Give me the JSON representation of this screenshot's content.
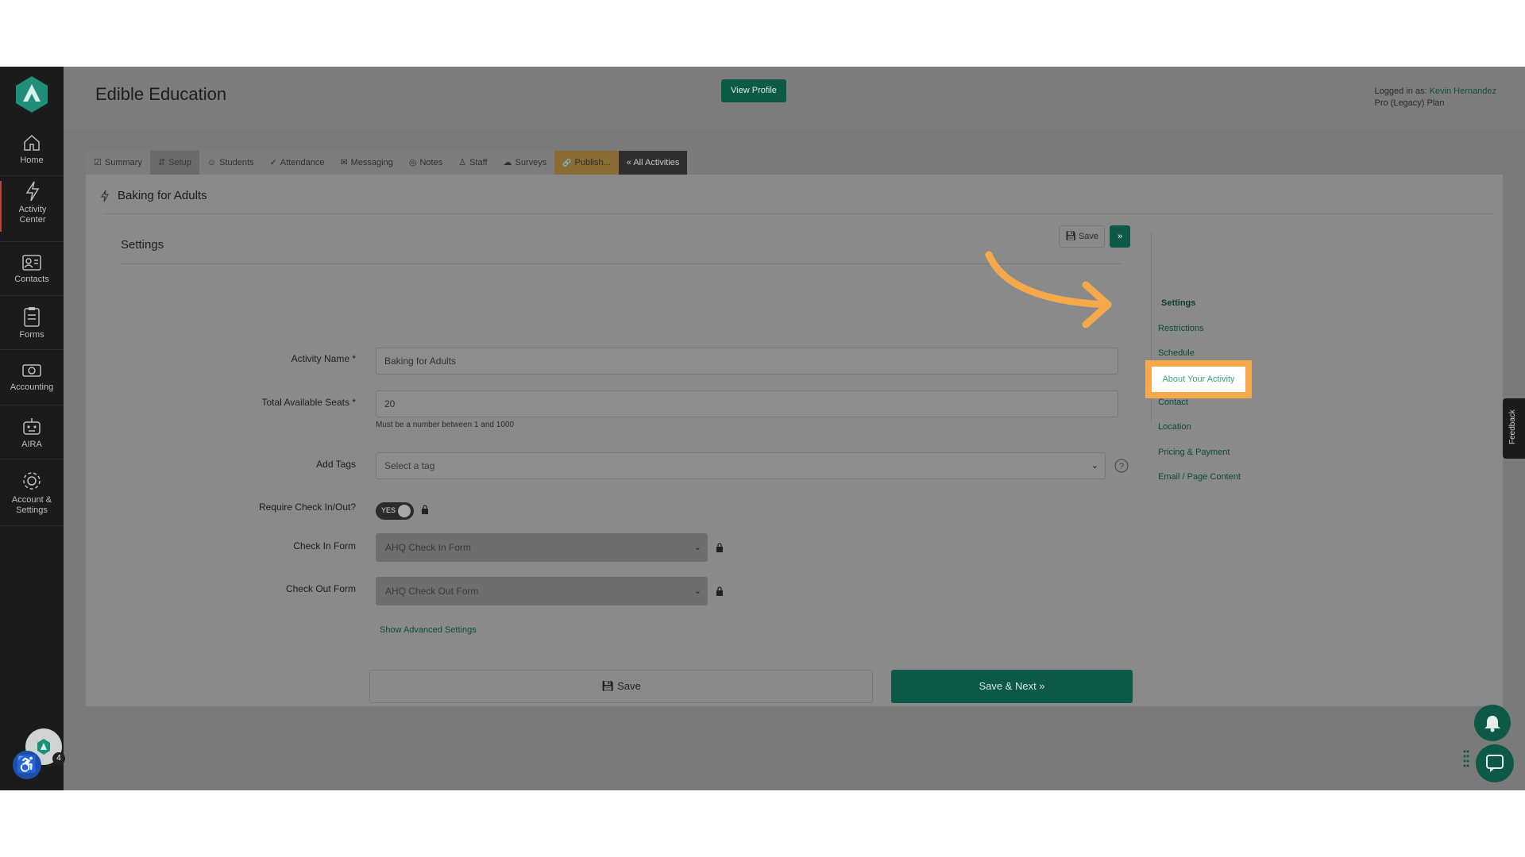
{
  "header": {
    "org_name": "Edible Education",
    "view_profile": "View Profile",
    "logged_in_label": "Logged in as:",
    "logged_in_user": "Kevin Hernandez",
    "plan": "Pro (Legacy) Plan"
  },
  "sidebar": {
    "items": [
      {
        "label": "Home",
        "icon": "home-icon"
      },
      {
        "label": "Activity Center",
        "icon": "lightning-icon"
      },
      {
        "label": "Contacts",
        "icon": "contacts-icon"
      },
      {
        "label": "Forms",
        "icon": "forms-icon"
      },
      {
        "label": "Accounting",
        "icon": "accounting-icon"
      },
      {
        "label": "AIRA",
        "icon": "robot-icon"
      },
      {
        "label": "Account & Settings",
        "icon": "gear-icon"
      }
    ],
    "notification_count": "4"
  },
  "tabs": [
    {
      "label": "Summary",
      "icon": "☑"
    },
    {
      "label": "Setup",
      "icon": "⇵"
    },
    {
      "label": "Students",
      "icon": "☺"
    },
    {
      "label": "Attendance",
      "icon": "✓"
    },
    {
      "label": "Messaging",
      "icon": "✉"
    },
    {
      "label": "Notes",
      "icon": "◎"
    },
    {
      "label": "Staff",
      "icon": "♙"
    },
    {
      "label": "Surveys",
      "icon": "☁"
    },
    {
      "label": "Publish...",
      "icon": "🔗"
    },
    {
      "label": "« All Activities",
      "icon": ""
    }
  ],
  "activity": {
    "title": "Baking for Adults"
  },
  "settings": {
    "title": "Settings",
    "top_save": "Save",
    "top_next": "»",
    "fields": {
      "activity_name": {
        "label": "Activity Name *",
        "value": "Baking for Adults"
      },
      "total_seats": {
        "label": "Total Available Seats *",
        "value": "20",
        "help": "Must be a number between 1 and 1000"
      },
      "add_tags": {
        "label": "Add Tags",
        "placeholder": "Select a tag"
      },
      "require_check": {
        "label": "Require Check In/Out?",
        "value": "YES"
      },
      "check_in_form": {
        "label": "Check In Form",
        "value": "AHQ Check In Form"
      },
      "check_out_form": {
        "label": "Check Out Form",
        "value": "AHQ Check Out Form"
      }
    },
    "advanced_link": "Show Advanced Settings",
    "bottom_save": "Save",
    "save_next": "Save & Next »"
  },
  "side_menu": {
    "items": [
      "Settings",
      "Restrictions",
      "Schedule",
      "About Your Activity",
      "Contact",
      "Location",
      "Pricing & Payment",
      "Email / Page Content"
    ],
    "highlighted": "About Your Activity"
  },
  "feedback": "Feedback",
  "colors": {
    "accent": "#0b5946",
    "highlight": "#f5a94a",
    "sidebar": "#1b1b1b"
  }
}
